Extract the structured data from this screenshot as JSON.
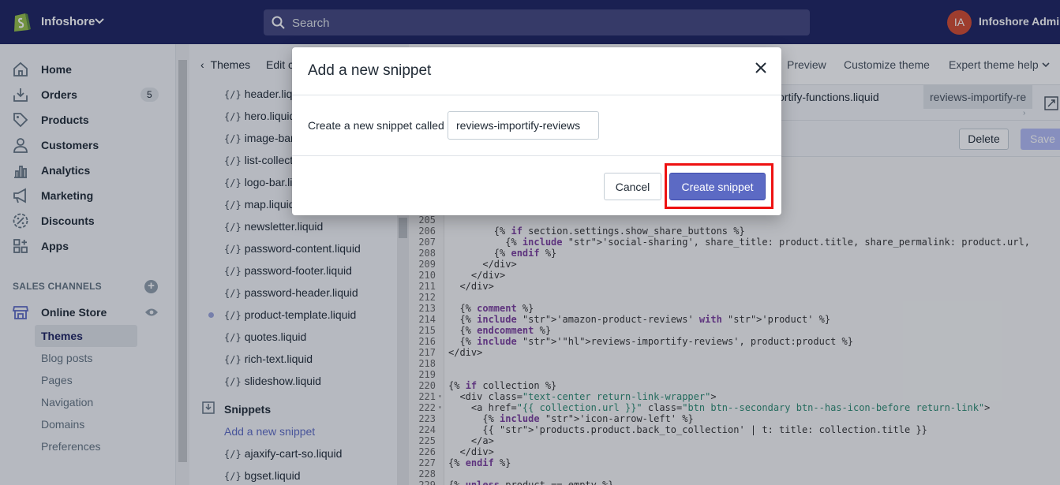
{
  "topbar": {
    "store_name": "Infoshore",
    "search_placeholder": "Search",
    "avatar_initials": "IA",
    "admin_name": "Infoshore Admin"
  },
  "sidebar": {
    "items": [
      {
        "label": "Home",
        "icon": "home-icon"
      },
      {
        "label": "Orders",
        "icon": "orders-icon",
        "badge": "5"
      },
      {
        "label": "Products",
        "icon": "tag-icon"
      },
      {
        "label": "Customers",
        "icon": "person-icon"
      },
      {
        "label": "Analytics",
        "icon": "bar-chart-icon"
      },
      {
        "label": "Marketing",
        "icon": "megaphone-icon"
      },
      {
        "label": "Discounts",
        "icon": "discount-icon"
      },
      {
        "label": "Apps",
        "icon": "apps-icon"
      }
    ],
    "sales_channels_title": "SALES CHANNELS",
    "online_store": "Online Store",
    "sub_items": [
      "Themes",
      "Blog posts",
      "Pages",
      "Navigation",
      "Domains",
      "Preferences"
    ]
  },
  "editor": {
    "back_label": "Themes",
    "edit_label": "Edit c",
    "tabs": [
      "Preview",
      "Customize theme",
      "Expert theme help"
    ],
    "file_tabs": [
      "ortify-functions.liquid",
      "reviews-importify-re"
    ],
    "delete_label": "Delete",
    "save_label": "Save",
    "files": [
      "header.liquid",
      "hero.liquid",
      "image-bar",
      "list-collect",
      "logo-bar.li",
      "map.liquid",
      "newsletter.liquid",
      "password-content.liquid",
      "password-footer.liquid",
      "password-header.liquid",
      "product-template.liquid",
      "quotes.liquid",
      "rich-text.liquid",
      "slideshow.liquid"
    ],
    "snippets_heading": "Snippets",
    "add_snippet_link": "Add a new snippet",
    "snippet_files": [
      "ajaxify-cart-so.liquid",
      "bgset.liquid"
    ],
    "code_lines": [
      {
        "n": "205",
        "t": ""
      },
      {
        "n": "206",
        "t": "        {% if section.settings.show_share_buttons %}"
      },
      {
        "n": "207",
        "t": "          {% include 'social-sharing', share_title: product.title, share_permalink: product.url,"
      },
      {
        "n": "208",
        "t": "        {% endif %}"
      },
      {
        "n": "209",
        "t": "      </div>"
      },
      {
        "n": "210",
        "t": "    </div>"
      },
      {
        "n": "211",
        "t": "  </div>"
      },
      {
        "n": "212",
        "t": ""
      },
      {
        "n": "213",
        "t": "  {% comment %}"
      },
      {
        "n": "214",
        "t": "  {% include 'amazon-product-reviews' with 'product' %}"
      },
      {
        "n": "215",
        "t": "  {% endcomment %}"
      },
      {
        "n": "216",
        "t": "  {% include 'reviews-importify-reviews', product:product %}"
      },
      {
        "n": "217",
        "t": "</div>"
      },
      {
        "n": "218",
        "t": ""
      },
      {
        "n": "219",
        "t": ""
      },
      {
        "n": "220",
        "t": "{% if collection %}"
      },
      {
        "n": "221",
        "t": "  <div class=\"text-center return-link-wrapper\">"
      },
      {
        "n": "222",
        "t": "    <a href=\"{{ collection.url }}\" class=\"btn btn--secondary btn--has-icon-before return-link\">"
      },
      {
        "n": "223",
        "t": "      {% include 'icon-arrow-left' %}"
      },
      {
        "n": "224",
        "t": "      {{ 'products.product.back_to_collection' | t: title: collection.title }}"
      },
      {
        "n": "225",
        "t": "    </a>"
      },
      {
        "n": "226",
        "t": "  </div>"
      },
      {
        "n": "227",
        "t": "{% endif %}"
      },
      {
        "n": "228",
        "t": ""
      },
      {
        "n": "229",
        "t": "{% unless product == empty %}"
      }
    ]
  },
  "modal": {
    "title": "Add a new snippet",
    "label": "Create a new snippet called",
    "input_value": "reviews-importify-reviews",
    "cancel_label": "Cancel",
    "create_label": "Create snippet",
    "accent": "#5c6ac4",
    "highlight_color": "#ee1111"
  }
}
